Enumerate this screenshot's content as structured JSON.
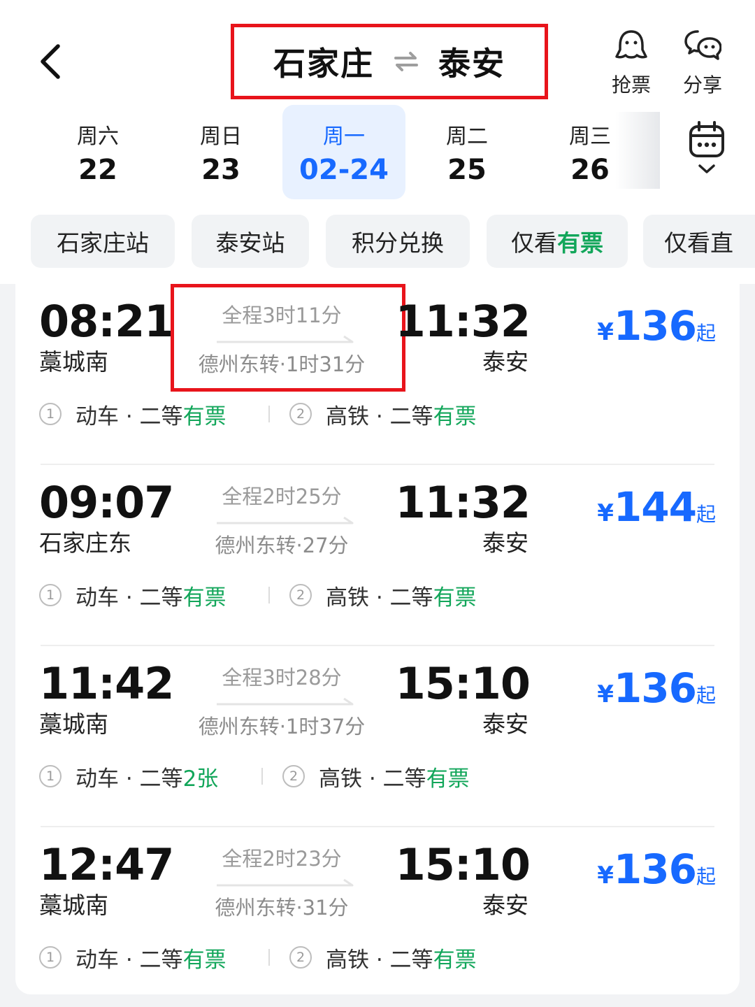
{
  "header": {
    "from": "石家庄",
    "to": "泰安",
    "grab_label": "抢票",
    "share_label": "分享"
  },
  "dates": [
    {
      "weekday": "周六",
      "day": "22",
      "active": false
    },
    {
      "weekday": "周日",
      "day": "23",
      "active": false
    },
    {
      "weekday": "周一",
      "day": "02-24",
      "active": true
    },
    {
      "weekday": "周二",
      "day": "25",
      "active": false
    },
    {
      "weekday": "周三",
      "day": "26",
      "active": false
    }
  ],
  "filters": {
    "chip1": "石家庄站",
    "chip2": "泰安站",
    "chip3": "积分兑换",
    "chip4_prefix": "仅看",
    "chip4_highlight": "有票",
    "chip5": "仅看直"
  },
  "colors": {
    "accent": "#1769ff",
    "available": "#12a65a",
    "highlight_border": "#e8141b"
  },
  "trains": [
    {
      "dep_time": "08:21",
      "dep_station": "藁城南",
      "duration": "全程3时11分",
      "via": "德州东转·1时31分",
      "arr_time": "11:32",
      "arr_station": "泰安",
      "price_symbol": "¥",
      "price": "136",
      "price_suffix": "起",
      "seg1": {
        "no": "1",
        "text": "动车 · 二等",
        "avail": "有票"
      },
      "seg2": {
        "no": "2",
        "text": "高铁 · 二等",
        "avail": "有票"
      }
    },
    {
      "dep_time": "09:07",
      "dep_station": "石家庄东",
      "duration": "全程2时25分",
      "via": "德州东转·27分",
      "arr_time": "11:32",
      "arr_station": "泰安",
      "price_symbol": "¥",
      "price": "144",
      "price_suffix": "起",
      "seg1": {
        "no": "1",
        "text": "动车 · 二等",
        "avail": "有票"
      },
      "seg2": {
        "no": "2",
        "text": "高铁 · 二等",
        "avail": "有票"
      }
    },
    {
      "dep_time": "11:42",
      "dep_station": "藁城南",
      "duration": "全程3时28分",
      "via": "德州东转·1时37分",
      "arr_time": "15:10",
      "arr_station": "泰安",
      "price_symbol": "¥",
      "price": "136",
      "price_suffix": "起",
      "seg1": {
        "no": "1",
        "text": "动车 · 二等",
        "avail": "2张"
      },
      "seg2": {
        "no": "2",
        "text": "高铁 · 二等",
        "avail": "有票"
      }
    },
    {
      "dep_time": "12:47",
      "dep_station": "藁城南",
      "duration": "全程2时23分",
      "via": "德州东转·31分",
      "arr_time": "15:10",
      "arr_station": "泰安",
      "price_symbol": "¥",
      "price": "136",
      "price_suffix": "起",
      "seg1": {
        "no": "1",
        "text": "动车 · 二等",
        "avail": "有票"
      },
      "seg2": {
        "no": "2",
        "text": "高铁 · 二等",
        "avail": "有票"
      }
    }
  ]
}
